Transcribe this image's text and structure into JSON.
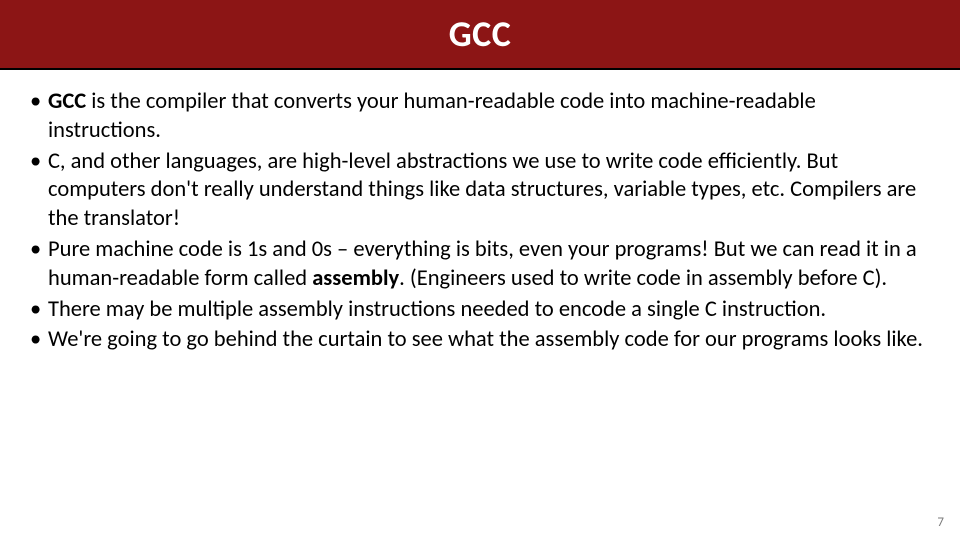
{
  "title": "GCC",
  "bullets": [
    {
      "bold": "GCC",
      "rest": " is the compiler that converts your human-readable code into machine-readable instructions."
    },
    {
      "text": "C, and other languages, are high-level abstractions we use to write code efficiently.  But computers don't really understand things like data structures, variable types, etc.  Compilers are the translator!"
    },
    {
      "pre": "Pure machine code is 1s and 0s – everything is bits, even your programs!  But we can read it in a human-readable form called ",
      "bold": "assembly",
      "post": ".  (Engineers used to write code in assembly before C)."
    },
    {
      "text": "There may be multiple assembly instructions needed to encode a single C instruction."
    },
    {
      "text": "We're going to go behind the curtain to see what the assembly code for our programs looks like."
    }
  ],
  "page_number": "7"
}
